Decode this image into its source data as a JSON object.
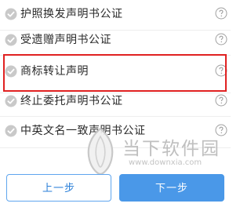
{
  "list": {
    "items": [
      {
        "label": "护照换发声明书公证"
      },
      {
        "label": "受遗赠声明书公证"
      },
      {
        "label": "商标转让声明"
      },
      {
        "label": "终止委托声明书公证"
      },
      {
        "label": "中英文名一致声明书公证"
      }
    ]
  },
  "footer": {
    "prev_label": "上一步",
    "next_label": "下一步"
  },
  "watermark": {
    "text": "当下软件园",
    "url": "www.downxia.com"
  },
  "colors": {
    "highlight": "#e02121",
    "primary": "#4a98e8",
    "check": "#c8c8c8"
  },
  "icons": {
    "check": "check-circle-icon",
    "help": "question-circle-icon",
    "watermark_logo": "downxia-logo-icon"
  }
}
